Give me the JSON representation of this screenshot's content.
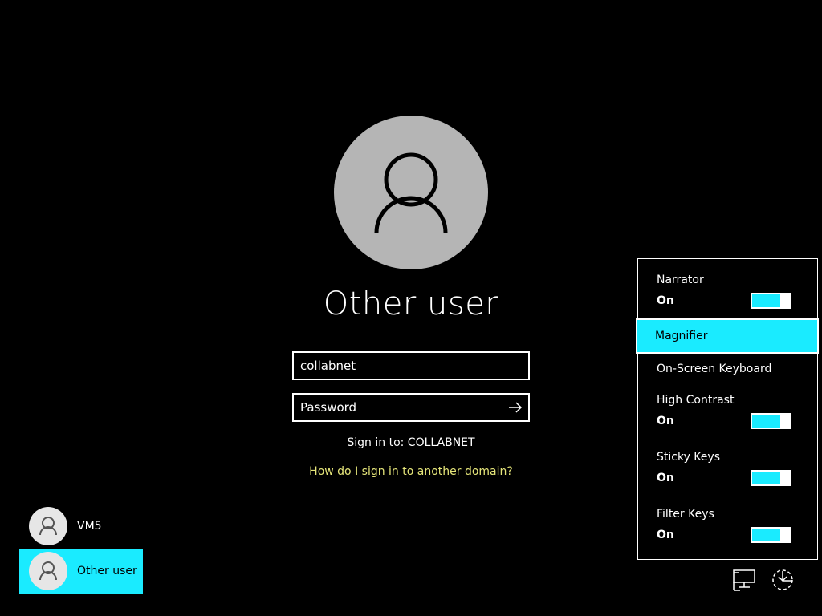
{
  "main": {
    "user_title": "Other user",
    "username_value": "collabnet",
    "password_placeholder": "Password",
    "sign_in_to": "Sign in to: COLLABNET",
    "domain_help_link": "How do I sign in to another domain?"
  },
  "user_list": [
    {
      "label": "VM5",
      "selected": false
    },
    {
      "label": "Other user",
      "selected": true
    }
  ],
  "ease_of_access": {
    "narrator": {
      "label": "Narrator",
      "state": "On",
      "on": true
    },
    "magnifier": {
      "label": "Magnifier",
      "highlighted": true
    },
    "osk": {
      "label": "On-Screen Keyboard"
    },
    "high_contrast": {
      "label": "High Contrast",
      "state": "On",
      "on": true
    },
    "sticky_keys": {
      "label": "Sticky Keys",
      "state": "On",
      "on": true
    },
    "filter_keys": {
      "label": "Filter Keys",
      "state": "On",
      "on": true
    }
  },
  "icons": {
    "network": "network-icon",
    "ease_of_access": "ease-of-access-icon",
    "submit": "arrow-right-icon"
  },
  "colors": {
    "accent": "#1aebff",
    "link": "#e6e67a",
    "avatar_bg": "#b5b5b5"
  }
}
